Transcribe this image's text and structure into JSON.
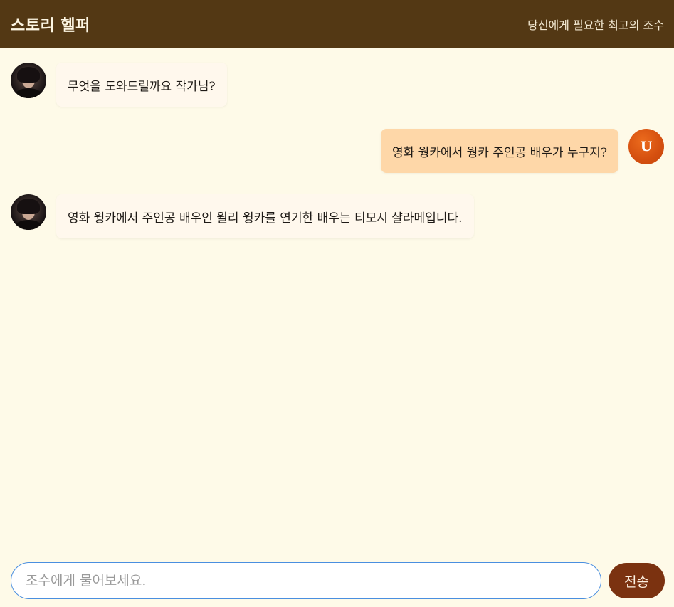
{
  "header": {
    "title": "스토리 헬퍼",
    "subtitle": "당신에게 필요한 최고의 조수"
  },
  "messages": [
    {
      "role": "bot",
      "text": "무엇을 도와드릴까요 작가님?"
    },
    {
      "role": "user",
      "avatar_letter": "U",
      "text": "영화 웡카에서 웡카 주인공 배우가 누구지?"
    },
    {
      "role": "bot",
      "text": "영화 웡카에서 주인공 배우인 윌리 웡카를 연기한 배우는 티모시 샬라메입니다."
    }
  ],
  "composer": {
    "placeholder": "조수에게 물어보세요.",
    "value": "",
    "send_label": "전송"
  },
  "colors": {
    "header_bg": "#533814",
    "page_bg": "#fefae8",
    "bot_bubble": "#fff8ed",
    "user_bubble": "#fed7a8",
    "user_avatar": "#d9530f",
    "send_button": "#7b3210",
    "input_border": "#4a8fe0"
  }
}
